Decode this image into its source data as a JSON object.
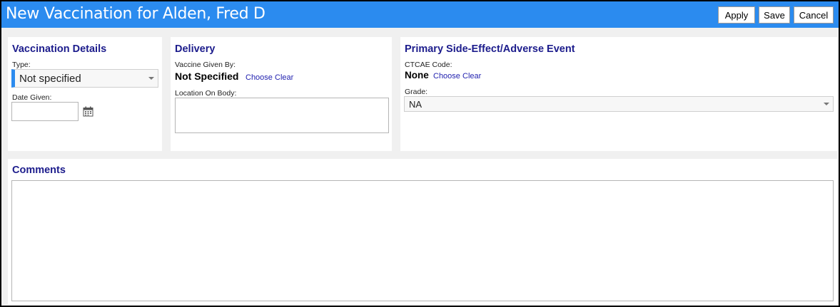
{
  "window": {
    "title": "New Vaccination for Alden, Fred D",
    "accent_color": "#2b8bef"
  },
  "toolbar": {
    "apply_label": "Apply",
    "save_label": "Save",
    "cancel_label": "Cancel"
  },
  "vaccination_details": {
    "title": "Vaccination Details",
    "type_label": "Type:",
    "type_value": "Not specified",
    "date_label": "Date Given:",
    "date_value": "",
    "calendar_icon": "calendar-icon"
  },
  "delivery": {
    "title": "Delivery",
    "given_by_label": "Vaccine Given By:",
    "given_by_value": "Not Specified",
    "choose_label": "Choose",
    "clear_label": "Clear",
    "location_label": "Location On Body:",
    "location_value": ""
  },
  "side_effect": {
    "title": "Primary Side-Effect/Adverse Event",
    "ctcae_label": "CTCAE Code:",
    "ctcae_value": "None",
    "choose_label": "Choose",
    "clear_label": "Clear",
    "grade_label": "Grade:",
    "grade_value": "NA"
  },
  "comments": {
    "title": "Comments",
    "value": ""
  }
}
